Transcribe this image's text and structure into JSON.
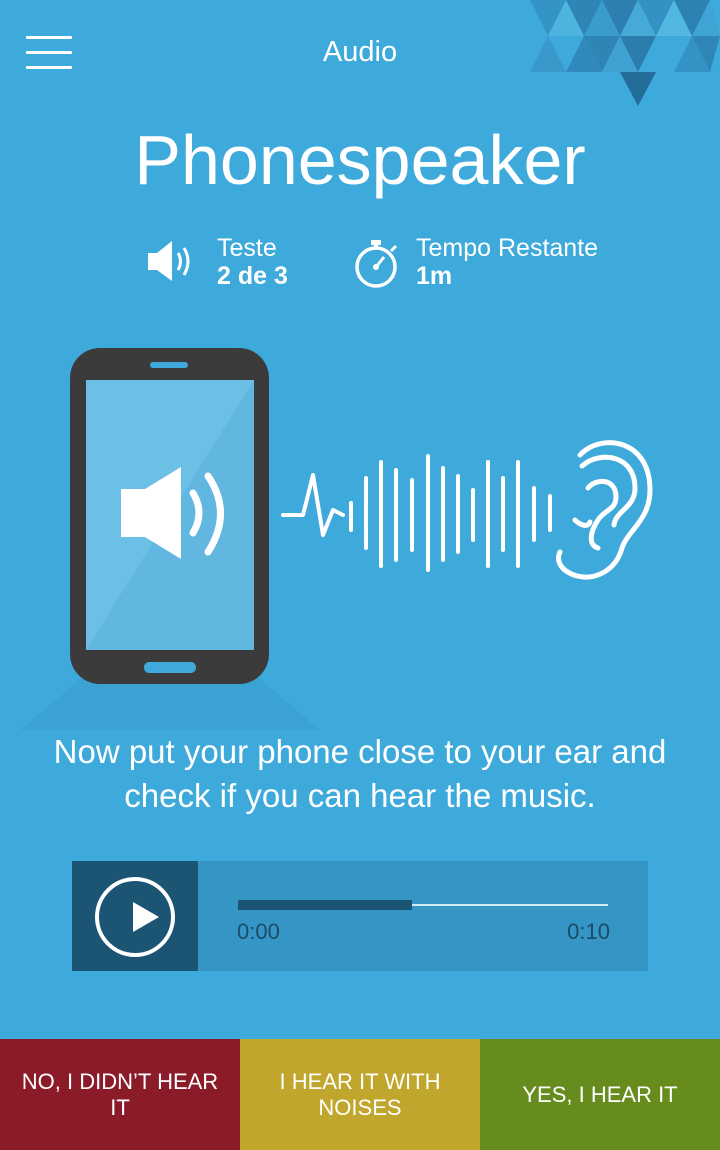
{
  "header": {
    "title": "Audio",
    "menu_icon": "hamburger-menu-icon"
  },
  "page_title": "Phonespeaker",
  "stats": {
    "test": {
      "icon": "speaker-icon",
      "label": "Teste",
      "value": "2 de 3"
    },
    "time": {
      "icon": "stopwatch-icon",
      "label": "Tempo Restante",
      "value": "1m"
    }
  },
  "illustration": {
    "phone_icon": "phone-speaker-icon",
    "wave_icon": "sound-wave-icon",
    "ear_icon": "ear-icon"
  },
  "instructions": "Now put your phone close to your ear and check if you can hear the music.",
  "player": {
    "play_icon": "play-icon",
    "current_time": "0:00",
    "duration": "0:10",
    "progress": 0.47
  },
  "answers": {
    "no": "NO, I DIDN’T HEAR IT",
    "noise": "I HEAR IT WITH NOISES",
    "yes": "YES, I HEAR IT"
  },
  "colors": {
    "background": "#3eaadb",
    "dark": "#1b5573",
    "no": "#8c1b2a",
    "noise": "#c0a62c",
    "yes": "#668c1e"
  }
}
